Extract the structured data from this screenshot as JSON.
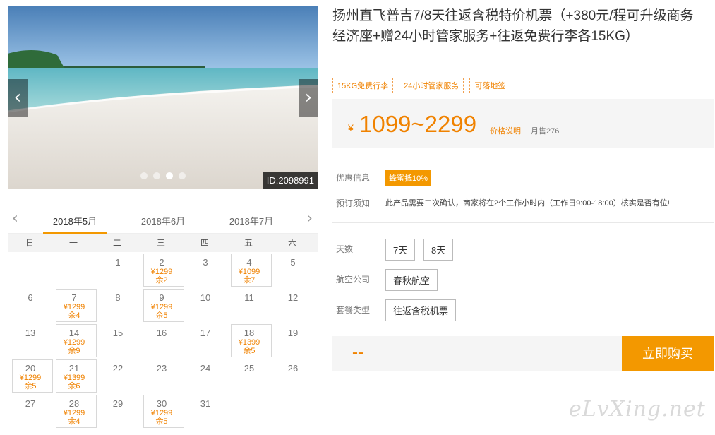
{
  "gallery": {
    "id_badge": "ID:2098991",
    "prev_glyph": "‹",
    "next_glyph": "›",
    "dot_count": 4,
    "active_dot": 2
  },
  "calendar": {
    "prev_glyph": "‹",
    "next_glyph": "›",
    "months": [
      "2018年5月",
      "2018年6月",
      "2018年7月"
    ],
    "active_month": 0,
    "weekdays": [
      "日",
      "一",
      "二",
      "三",
      "四",
      "五",
      "六"
    ],
    "first_weekday": 2,
    "days_in_month": 31,
    "available": [
      {
        "day": 2,
        "price": "¥1299",
        "stock": "余2"
      },
      {
        "day": 4,
        "price": "¥1099",
        "stock": "余7"
      },
      {
        "day": 7,
        "price": "¥1299",
        "stock": "余4"
      },
      {
        "day": 9,
        "price": "¥1299",
        "stock": "余5"
      },
      {
        "day": 14,
        "price": "¥1299",
        "stock": "余9"
      },
      {
        "day": 18,
        "price": "¥1399",
        "stock": "余5"
      },
      {
        "day": 20,
        "price": "¥1299",
        "stock": "余5"
      },
      {
        "day": 21,
        "price": "¥1399",
        "stock": "余6"
      },
      {
        "day": 28,
        "price": "¥1299",
        "stock": "余4"
      },
      {
        "day": 30,
        "price": "¥1299",
        "stock": "余5"
      }
    ]
  },
  "product": {
    "title": "扬州直飞普吉7/8天往返含税特价机票（+380元/程可升级商务经济座+赠24小时管家服务+往返免费行李各15KG）",
    "tags": [
      "15KG免费行李",
      "24小时管家服务",
      "可落地签"
    ],
    "price_symbol": "¥",
    "price_range": "1099~2299",
    "price_explain": "价格说明",
    "monthly_sales": "月售276",
    "promo_label": "优惠信息",
    "promo_badge": "蜂蜜抵10%",
    "notice_label": "预订须知",
    "notice_text": "此产品需要二次确认，商家将在2个工作小时内（工作日9:00-18:00）核实是否有位!",
    "days_label": "天数",
    "days_options": [
      "7天",
      "8天"
    ],
    "airline_label": "航空公司",
    "airline_option": "春秋航空",
    "package_label": "套餐类型",
    "package_option": "往返含税机票",
    "total_placeholder": "--",
    "buy_label": "立即购买"
  },
  "watermark": "eLvXing.net",
  "colors": {
    "accent": "#f39800",
    "price": "#f08200"
  }
}
